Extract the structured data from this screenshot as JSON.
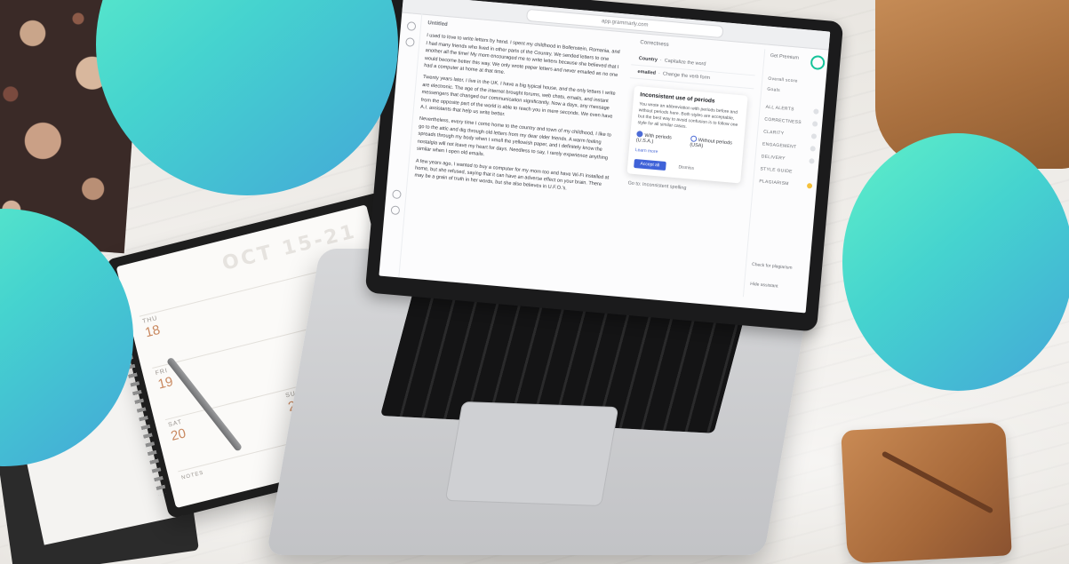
{
  "browser": {
    "url": "app.grammarly.com"
  },
  "document": {
    "title": "Untitled",
    "paragraphs": [
      "I used to love to write letters by hand. I spent my childhood in Bollenstein, Romania, and I had many friends who lived in other parts of the Country. We sended letters to one another all the time! My mom encouraged me to write letters because she believed that I would become better this way. We only wrote paper letters and never emailed as no one had a computer at home at that time.",
      "Twenty years later, I live in the UK. I have a big typical house, and the only letters I write are electronic. The age of the internet brought forums, web chats, emails, and instant messengers that changed our communication significantly. Now a days, any message from the opposite part of the world is able to reach you in mere seconds. We even have A.I. assistants that help us write better.",
      "Nevertheless, every time I come home to the country and town of my childhood, I like to go to the attic and dig through old letters from my dear older friends. A warm feeling spreads through my body when I smell the yellowish paper, and I definitely know the nostalgia will not leave my heart for days. Needless to say, I rarely experience anything similar when I open old emails.",
      "A few years ago, I wanted to buy a computer for my mom too and have Wi-Fi installed at home, but she refused, saying that it can have an adverse effect on your brain. There may be a grain of truth in her words, but she also believes in U.F.O.'s."
    ]
  },
  "assistant_panel": {
    "header": "Correctness",
    "suggestions": [
      {
        "label": "Country",
        "hint": "Capitalize the word"
      },
      {
        "label": "emailed",
        "hint": "Change the verb form"
      }
    ],
    "card": {
      "title": "Inconsistent use of periods",
      "body": "You wrote an abbreviation with periods before and without periods here. Both styles are acceptable, but the best way to avoid confusion is to follow one style for all similar cases.",
      "option_with": "With periods (U.S.A.)",
      "option_without": "Without periods (USA)",
      "learn_more": "Learn more",
      "primary_button": "Accept all",
      "secondary": "Dismiss"
    },
    "footer": "Go to: Inconsistent spelling"
  },
  "right_sidebar": {
    "upgrade_label": "Get Premium",
    "score_label": "Overall score",
    "goals_label": "Goals",
    "items": [
      "ALL ALERTS",
      "CORRECTNESS",
      "CLARITY",
      "ENGAGEMENT",
      "DELIVERY",
      "STYLE GUIDE",
      "PLAGIARISM"
    ],
    "footer_items": [
      "Check for plagiarism",
      "Hide assistant"
    ]
  },
  "planner": {
    "week_label": "OCT 15-21",
    "days": [
      {
        "name": "THU",
        "number": "18"
      },
      {
        "name": "FRI",
        "number": "19"
      },
      {
        "name": "SAT",
        "number": "20"
      },
      {
        "name": "SUN",
        "number": "21"
      }
    ],
    "notes_label": "NOTES"
  },
  "colors": {
    "accent_teal": "#45d3cf",
    "grammarly_green": "#15c39a",
    "button_blue": "#3f62d8",
    "warning_yellow": "#f5c13c"
  }
}
